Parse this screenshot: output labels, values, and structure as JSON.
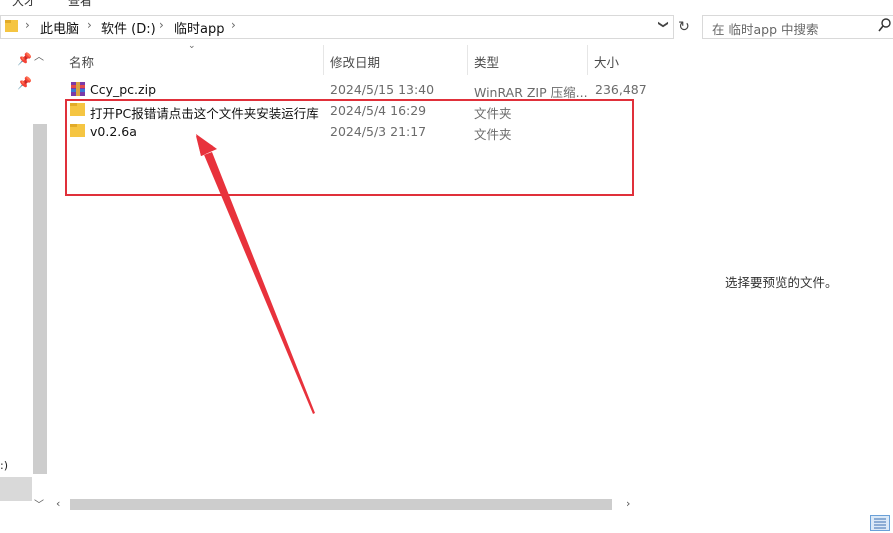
{
  "ribbon": {
    "frag_a": "大才",
    "frag_b": "查看"
  },
  "address": {
    "crumbs": [
      "此电脑",
      "软件 (D:)",
      "临时app"
    ],
    "dropdown_glyph": "❯",
    "refresh_glyph": "↻"
  },
  "search": {
    "placeholder": "在 临时app 中搜索",
    "icon": "search-icon"
  },
  "nav": {
    "drive_label": ":)"
  },
  "columns": {
    "name": "名称",
    "date": "修改日期",
    "type": "类型",
    "size": "大小"
  },
  "files": [
    {
      "name": "Ccy_pc.zip",
      "date": "2024/5/15 13:40",
      "type": "WinRAR ZIP 压缩...",
      "size": "236,487",
      "icon": "winrar-zip-icon"
    },
    {
      "name": "打开PC报错请点击这个文件夹安装运行库",
      "date": "2024/5/4 16:29",
      "type": "文件夹",
      "size": "",
      "icon": "folder-icon"
    },
    {
      "name": "v0.2.6a",
      "date": "2024/5/3 21:17",
      "type": "文件夹",
      "size": "",
      "icon": "folder-icon"
    }
  ],
  "preview": {
    "message": "选择要预览的文件。"
  },
  "colors": {
    "highlight": "#e0303a",
    "arrow": "#e8323c",
    "folder": "#f5c542"
  }
}
